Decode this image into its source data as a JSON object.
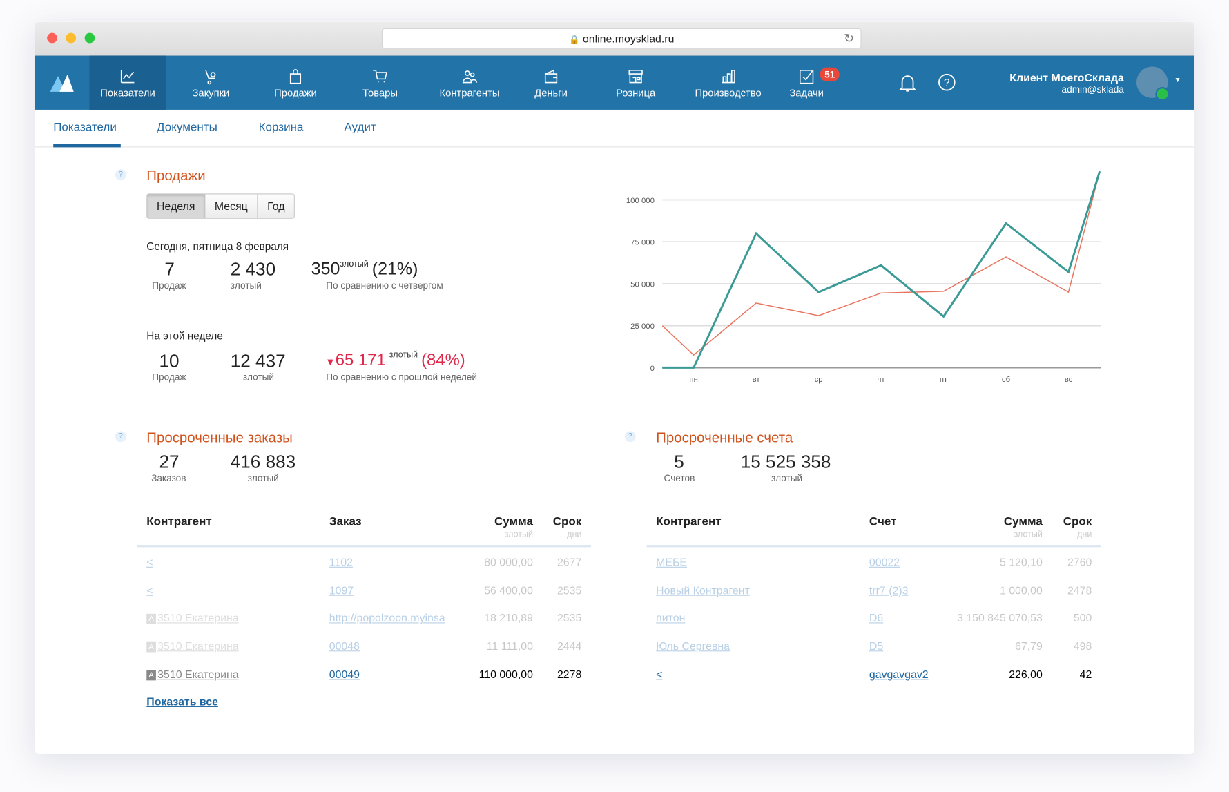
{
  "browser": {
    "url": "online.moysklad.ru"
  },
  "nav": {
    "items": [
      {
        "label": "Показатели",
        "icon": "chart-icon",
        "active": true
      },
      {
        "label": "Закупки",
        "icon": "purchase-icon"
      },
      {
        "label": "Продажи",
        "icon": "bag-icon"
      },
      {
        "label": "Товары",
        "icon": "cart-icon"
      },
      {
        "label": "Контрагенты",
        "icon": "people-icon"
      },
      {
        "label": "Деньги",
        "icon": "wallet-icon"
      },
      {
        "label": "Розница",
        "icon": "store-icon"
      },
      {
        "label": "Производство",
        "icon": "factory-icon"
      },
      {
        "label": "Задачи",
        "icon": "tasks-icon"
      }
    ],
    "tasks_badge": "51",
    "user_name": "Клиент МоегоСклада",
    "user_login": "admin@sklada"
  },
  "subnav": {
    "tabs": [
      "Показатели",
      "Документы",
      "Корзина",
      "Аудит"
    ],
    "active": "Показатели"
  },
  "sales": {
    "title": "Продажи",
    "periods": [
      "Неделя",
      "Месяц",
      "Год"
    ],
    "active_period": "Неделя",
    "today": {
      "heading": "Сегодня, пятница 8 февраля",
      "count": "7",
      "count_label": "Продаж",
      "sum": "2 430",
      "sum_label": "злотый",
      "diff": "350",
      "diff_unit": "злотый",
      "diff_pct": "(21%)",
      "diff_label": "По сравнению с четвергом"
    },
    "week": {
      "heading": "На этой неделе",
      "count": "10",
      "count_label": "Продаж",
      "sum": "12 437",
      "sum_label": "злотый",
      "diff": "65 171",
      "diff_unit": "злотый",
      "diff_pct": "(84%)",
      "diff_label": "По сравнению с прошлой неделей",
      "trend": "down"
    }
  },
  "chart_data": {
    "type": "line",
    "categories": [
      "",
      "пн",
      "вт",
      "ср",
      "чт",
      "пт",
      "сб",
      "вс",
      ""
    ],
    "series": [
      {
        "color": "#3a9a96",
        "values": [
          0,
          0,
          80000,
          45000,
          61000,
          30500,
          86000,
          57000,
          117000
        ]
      },
      {
        "color": "#e8735e",
        "values": [
          25000,
          7500,
          38500,
          31000,
          44500,
          45500,
          66000,
          45000,
          117000
        ]
      }
    ],
    "yticks": [
      "0",
      "25 000",
      "50 000",
      "75 000",
      "100 000"
    ],
    "ytick_values": [
      0,
      25000,
      50000,
      75000,
      100000
    ],
    "ylim": [
      0,
      117000
    ],
    "grid": true
  },
  "orders": {
    "title": "Просроченные заказы",
    "count": "27",
    "count_label": "Заказов",
    "sum": "416 883",
    "sum_label": "злотый",
    "headers": {
      "c1": "Контрагент",
      "c2": "Заказ",
      "c3": "Сумма",
      "c3sub": "злотый",
      "c4": "Срок",
      "c4sub": "дни"
    },
    "rows": [
      {
        "agent": "<",
        "doc": "1102",
        "sum": "80 000,00",
        "days": "2677"
      },
      {
        "agent": "<",
        "doc": "1097",
        "sum": "56 400,00",
        "days": "2535"
      },
      {
        "agent": "3510 Екатерина",
        "tag": "A",
        "doc": "http://popolzoon.myinsa",
        "sum": "18 210,89",
        "days": "2535"
      },
      {
        "agent": "3510 Екатерина",
        "tag": "A",
        "doc": "00048",
        "sum": "11 111,00",
        "days": "2444"
      },
      {
        "agent": "3510 Екатерина",
        "tag": "A",
        "doc": "00049",
        "sum": "110 000,00",
        "days": "2278"
      }
    ],
    "show_all": "Показать все"
  },
  "invoices": {
    "title": "Просроченные счета",
    "count": "5",
    "count_label": "Счетов",
    "sum": "15 525 358",
    "sum_label": "злотый",
    "headers": {
      "c1": "Контрагент",
      "c2": "Счет",
      "c3": "Сумма",
      "c3sub": "злотый",
      "c4": "Срок",
      "c4sub": "дни"
    },
    "rows": [
      {
        "agent": "МЕБЕ",
        "doc": "00022",
        "sum": "5 120,10",
        "days": "2760"
      },
      {
        "agent": "Новый Контрагент",
        "doc": "trr7 (2)3",
        "sum": "1 000,00",
        "days": "2478"
      },
      {
        "agent": "питон",
        "doc": "D6",
        "sum": "3 150 845 070,53",
        "days": "500"
      },
      {
        "agent": "Юль Сергевна",
        "doc": "D5",
        "sum": "67,79",
        "days": "498"
      },
      {
        "agent": "<",
        "doc": "gavgavgav2",
        "sum": "226,00",
        "days": "42"
      }
    ]
  }
}
